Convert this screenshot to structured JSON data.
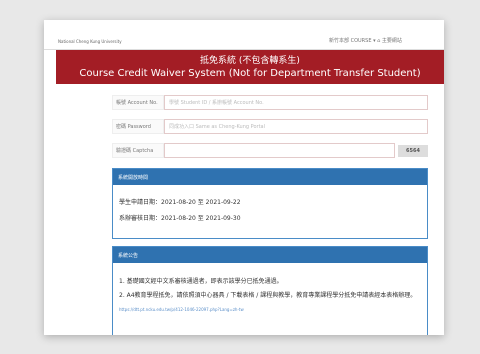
{
  "header": {
    "logo_text": "National Cheng Kung University",
    "user_menu": "新竹本部 COURSE ▾   ⌂ 主要網站"
  },
  "banner": {
    "title_zh": "抵免系統 (不包含轉系生)",
    "title_en": "Course Credit Waiver System (Not for Department Transfer Student)"
  },
  "form": {
    "account_label": "帳號 Account No.",
    "account_placeholder": "學號 Student ID / 系辦帳號 Account No.",
    "password_label": "密碼 Password",
    "password_placeholder": "同成功入口 Same as Cheng-Kung Portal",
    "captcha_label": "驗證碼 Captcha",
    "captcha_code": "6564"
  },
  "schedule_panel": {
    "title": "系統開放時間",
    "student_period": "學生申請日期：2021-08-20 至 2021-09-22",
    "dept_period": "系辦審核日期：2021-08-20 至 2021-09-30"
  },
  "notice_panel": {
    "title": "系統公告",
    "note1": "1. 基礎國文經中文系審核通過者，即表示該學分已抵免通過。",
    "note2": "2. A4教育學程抵免，請依照須中心器具 / 下載表格 / 課程與教學，教育專業課程學分抵免申請表經本表格辦理。",
    "link": "https://dtt.pt.ncku.edu.tw/p/412-1046-22097.php?Lang=zh-tw"
  }
}
